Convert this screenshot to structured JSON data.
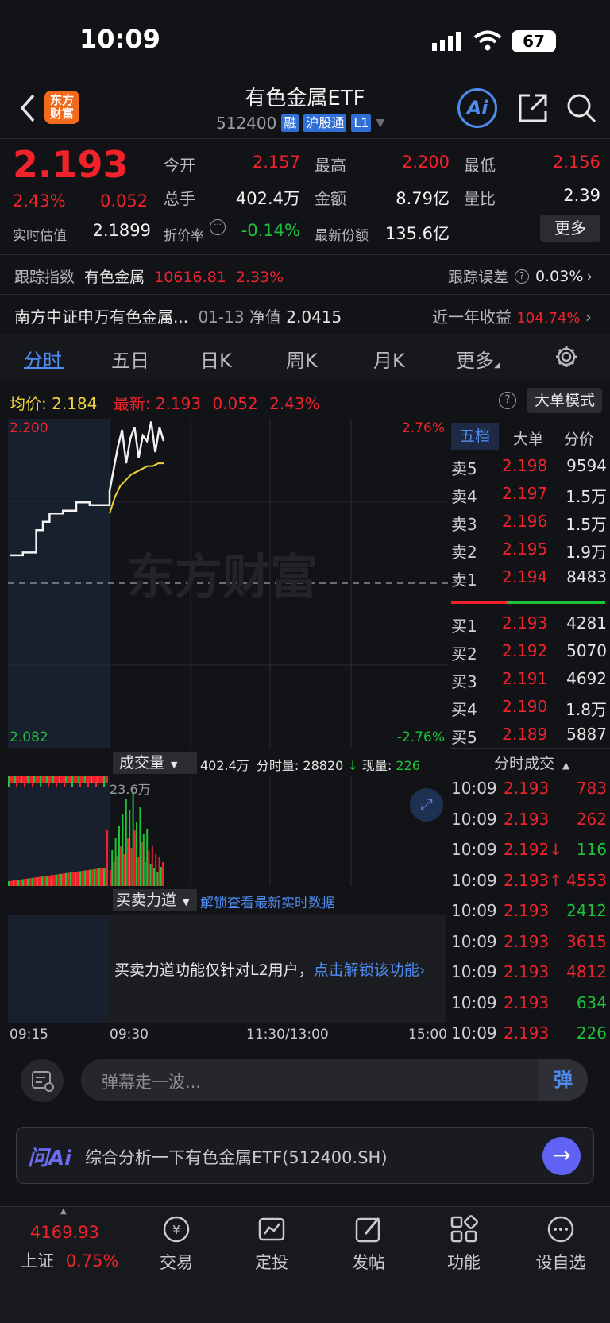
{
  "status": {
    "time": "10:09",
    "battery": "67"
  },
  "header": {
    "title": "有色金属ETF",
    "code": "512400",
    "tags": [
      "融",
      "沪股通",
      "L1"
    ]
  },
  "quote": {
    "price": "2.193",
    "pct": "2.43%",
    "chg": "0.052",
    "rows": [
      {
        "l1": "今开",
        "v1": "2.157",
        "l2": "最高",
        "v2": "2.200",
        "l3": "最低",
        "v3": "2.156"
      },
      {
        "l1": "总手",
        "v1": "402.4万",
        "l2": "金额",
        "v2": "8.79亿",
        "l3": "量比",
        "v3": "2.39"
      }
    ],
    "est_label": "实时估值",
    "est_value": "2.1899",
    "disc_label": "折价率",
    "disc_value": "-0.14%",
    "share_label": "最新份额",
    "share_value": "135.6亿",
    "more": "更多"
  },
  "tracking": {
    "label": "跟踪指数",
    "index": "有色金属",
    "value": "10616.81",
    "pct": "2.33%",
    "err_label": "跟踪误差",
    "err_value": "0.03%"
  },
  "fund": {
    "name": "南方中证申万有色金属...",
    "date": "01-13",
    "nav_label": "净值",
    "nav": "2.0415",
    "ret_label": "近一年收益",
    "ret": "104.74%"
  },
  "tabs": [
    "分时",
    "五日",
    "日K",
    "周K",
    "月K",
    "更多"
  ],
  "chart_info": {
    "avg_label": "均价:",
    "avg": "2.184",
    "last_label": "最新:",
    "last": "2.193",
    "chg": "0.052",
    "pct": "2.43%",
    "mode": "大单模式"
  },
  "chart_data": {
    "type": "line",
    "y_top": "2.200",
    "y_bottom": "2.082",
    "pct_top": "2.76%",
    "pct_bottom": "-2.76%",
    "x_labels": [
      "09:15",
      "09:30",
      "11:30/13:00",
      "15:00"
    ],
    "watermark": "东方财富",
    "price": [
      2.151,
      2.151,
      2.152,
      2.152,
      2.16,
      2.163,
      2.166,
      2.166,
      2.167,
      2.167,
      2.17,
      2.17,
      2.169,
      2.169,
      2.169,
      2.169,
      2.174,
      2.182,
      2.19,
      2.196,
      2.184,
      2.193,
      2.197,
      2.186,
      2.194,
      2.192,
      2.199,
      2.188,
      2.197,
      2.192
    ],
    "avg": [
      2.166,
      2.172,
      2.176,
      2.178,
      2.18,
      2.181,
      2.182,
      2.183,
      2.183,
      2.184,
      2.184
    ],
    "vol_total": "402.4万",
    "vol_scale": "23.6万"
  },
  "vol_bar": {
    "label": "成交量",
    "total": "402.4万",
    "period_label": "分时量:",
    "period": "28820",
    "now_label": "现量:",
    "now": "226"
  },
  "force": {
    "label": "买卖力道",
    "unlock": "解锁查看最新实时数据",
    "msg": "买卖力道功能仅针对L2用户，",
    "link": "点击解锁该功能"
  },
  "orderbook": {
    "tabs": [
      "五档",
      "大单",
      "分价"
    ],
    "asks": [
      {
        "n": "卖5",
        "p": "2.198",
        "v": "9594"
      },
      {
        "n": "卖4",
        "p": "2.197",
        "v": "1.5万"
      },
      {
        "n": "卖3",
        "p": "2.196",
        "v": "1.5万"
      },
      {
        "n": "卖2",
        "p": "2.195",
        "v": "1.9万"
      },
      {
        "n": "卖1",
        "p": "2.194",
        "v": "8483"
      }
    ],
    "bids": [
      {
        "n": "买1",
        "p": "2.193",
        "v": "4281"
      },
      {
        "n": "买2",
        "p": "2.192",
        "v": "5070"
      },
      {
        "n": "买3",
        "p": "2.191",
        "v": "4692"
      },
      {
        "n": "买4",
        "p": "2.190",
        "v": "1.8万"
      },
      {
        "n": "买5",
        "p": "2.189",
        "v": "5887"
      }
    ]
  },
  "trades": {
    "title": "分时成交",
    "rows": [
      {
        "t": "10:09",
        "p": "2.193",
        "v": "783",
        "c": "red"
      },
      {
        "t": "10:09",
        "p": "2.193",
        "v": "262",
        "c": "red"
      },
      {
        "t": "10:09",
        "p": "2.192↓",
        "v": "116",
        "c": "green"
      },
      {
        "t": "10:09",
        "p": "2.193↑",
        "v": "4553",
        "c": "red"
      },
      {
        "t": "10:09",
        "p": "2.193",
        "v": "2412",
        "c": "green"
      },
      {
        "t": "10:09",
        "p": "2.193",
        "v": "3615",
        "c": "red"
      },
      {
        "t": "10:09",
        "p": "2.193",
        "v": "4812",
        "c": "red"
      },
      {
        "t": "10:09",
        "p": "2.193",
        "v": "634",
        "c": "green"
      },
      {
        "t": "10:09",
        "p": "2.193",
        "v": "226",
        "c": "green"
      }
    ]
  },
  "danmu": {
    "placeholder": "弹幕走一波...",
    "btn": "弹"
  },
  "ask": {
    "logo": "问Ai",
    "text": "综合分析一下有色金属ETF(512400.SH)"
  },
  "nav": {
    "index_value": "4169.93",
    "index_name": "上证",
    "index_pct": "0.75%",
    "items": [
      "交易",
      "定投",
      "发帖",
      "功能",
      "设自选"
    ]
  }
}
